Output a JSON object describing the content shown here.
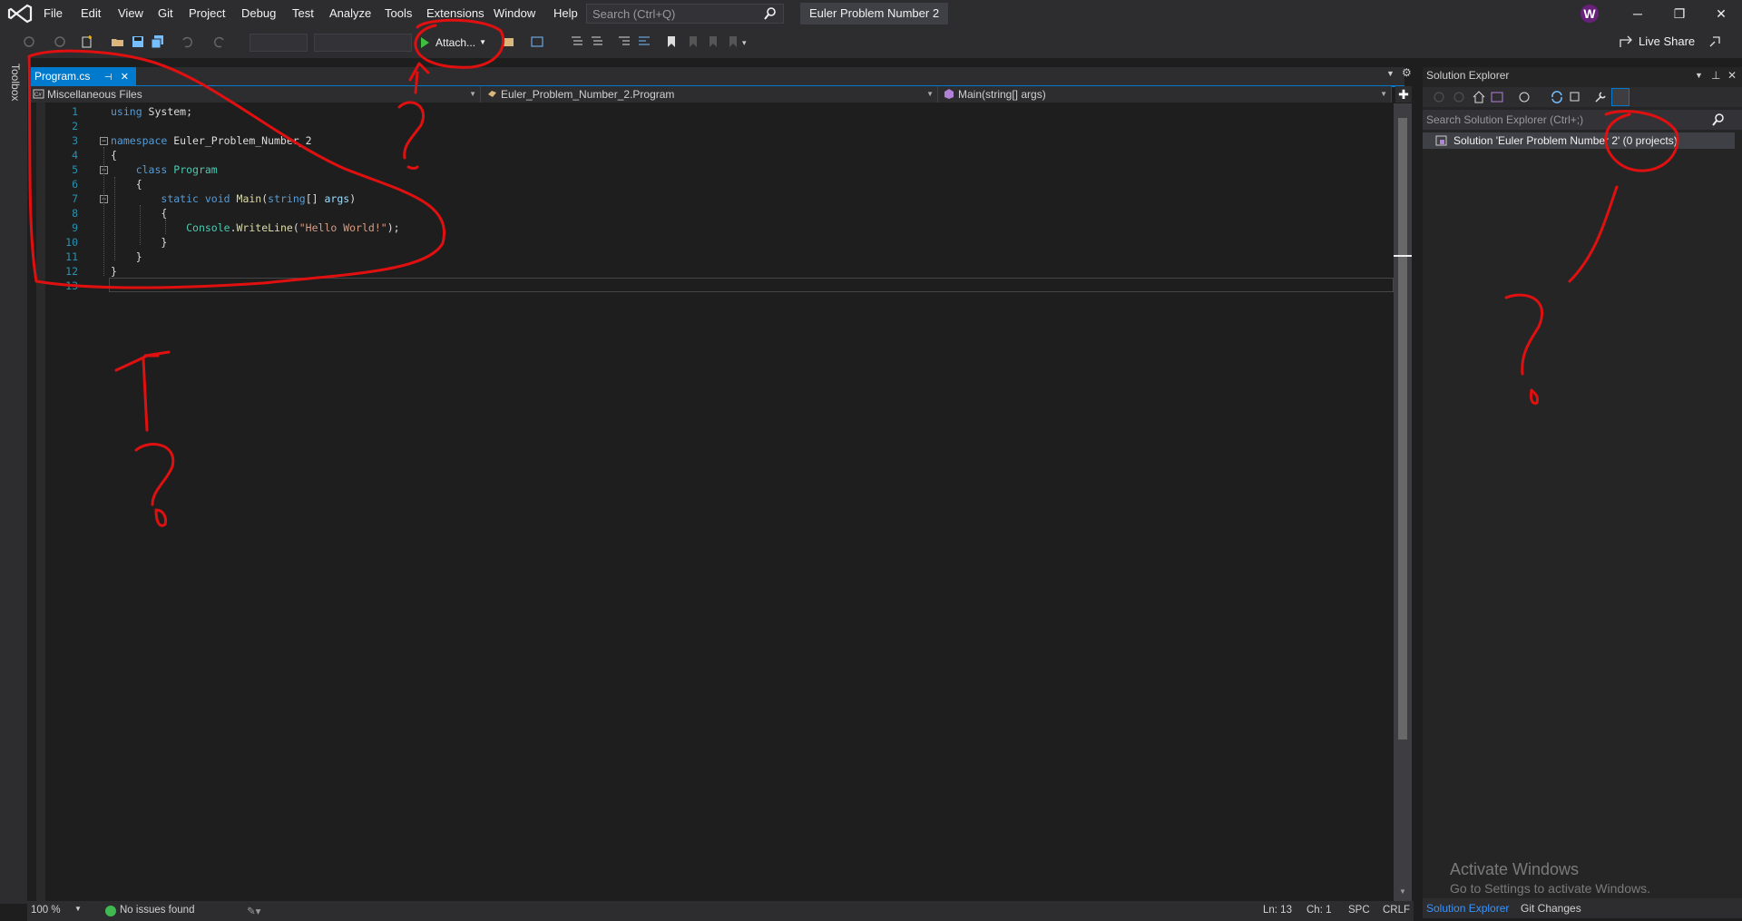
{
  "menu": [
    "File",
    "Edit",
    "View",
    "Git",
    "Project",
    "Debug",
    "Test",
    "Analyze",
    "Tools",
    "Extensions",
    "Window",
    "Help"
  ],
  "search": {
    "placeholder": "Search (Ctrl+Q)"
  },
  "solution_title": "Euler Problem Number 2",
  "user_initial": "W",
  "toolbar": {
    "attach_label": "Attach...",
    "live_share_label": "Live Share"
  },
  "toolbox_label": "Toolbox",
  "tab": {
    "label": "Program.cs"
  },
  "navbar": {
    "files_scope": "Miscellaneous Files",
    "type_scope": "Euler_Problem_Number_2.Program",
    "member_scope": "Main(string[] args)"
  },
  "code_lines": [
    "1",
    "2",
    "3",
    "4",
    "5",
    "6",
    "7",
    "8",
    "9",
    "10",
    "11",
    "12",
    "13"
  ],
  "solution_explorer": {
    "title": "Solution Explorer",
    "search_placeholder": "Search Solution Explorer (Ctrl+;)",
    "solution_row": "Solution 'Euler Problem Number 2' (0 projects)",
    "tabs": [
      "Solution Explorer",
      "Git Changes"
    ]
  },
  "activation": {
    "title": "Activate Windows",
    "subtitle": "Go to Settings to activate Windows."
  },
  "status": {
    "zoom": "100 %",
    "issues": "No issues found",
    "ln": "Ln: 13",
    "ch": "Ch: 1",
    "spc": "SPC",
    "eol": "CRLF"
  },
  "colors": {
    "accent": "#007acc",
    "annotation": "#e01010"
  }
}
